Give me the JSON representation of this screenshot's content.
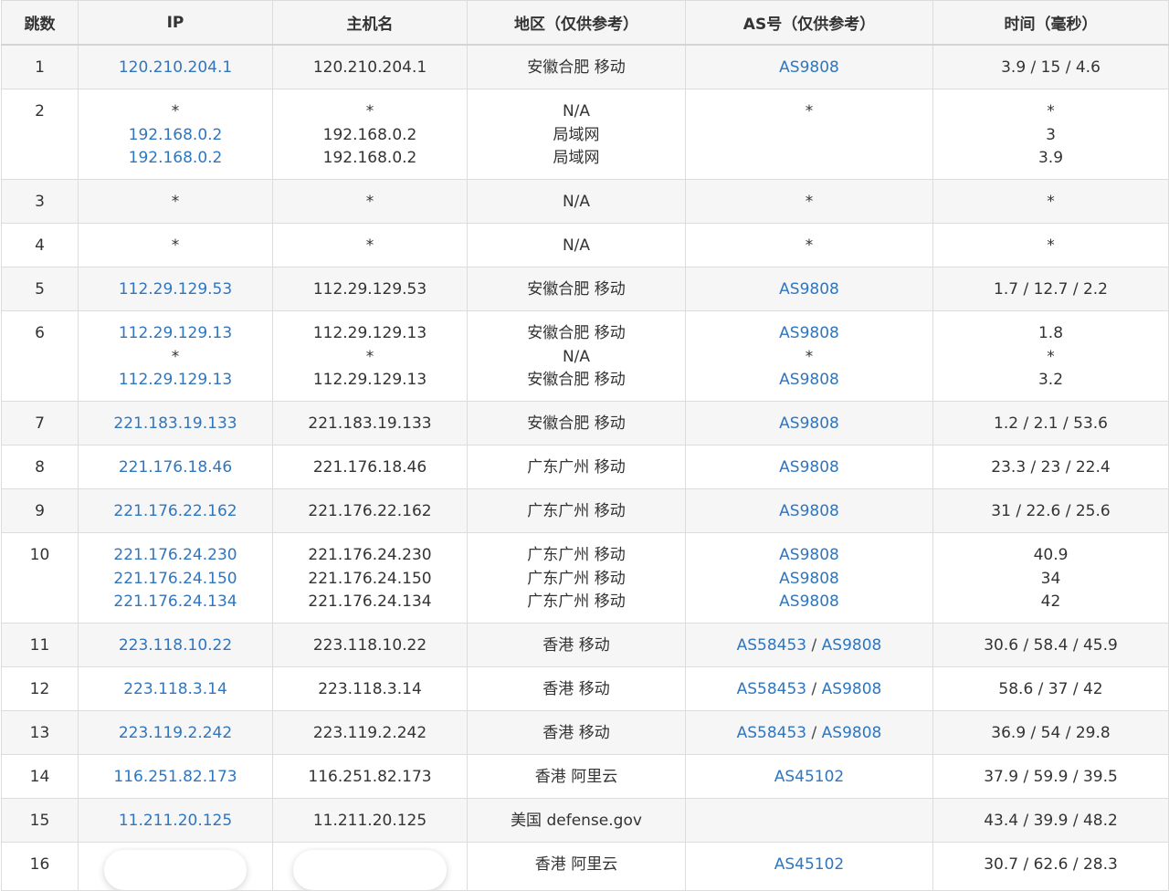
{
  "headers": [
    "跳数",
    "IP",
    "主机名",
    "地区（仅供参考）",
    "AS号（仅供参考）",
    "时间（毫秒）"
  ],
  "rows": [
    {
      "hop": "1",
      "ip": [
        "120.210.204.1"
      ],
      "host": [
        "120.210.204.1"
      ],
      "region": [
        "安徽合肥 移动"
      ],
      "as": [
        [
          "AS9808"
        ]
      ],
      "time": [
        "3.9 / 15 / 4.6"
      ]
    },
    {
      "hop": "2",
      "ip": [
        "*",
        "192.168.0.2",
        "192.168.0.2"
      ],
      "host": [
        "*",
        "192.168.0.2",
        "192.168.0.2"
      ],
      "region": [
        "N/A",
        "局域网",
        "局域网"
      ],
      "as": [
        [
          "*"
        ]
      ],
      "time": [
        "*",
        "3",
        "3.9"
      ]
    },
    {
      "hop": "3",
      "ip": [
        "*"
      ],
      "host": [
        "*"
      ],
      "region": [
        "N/A"
      ],
      "as": [
        [
          "*"
        ]
      ],
      "time": [
        "*"
      ]
    },
    {
      "hop": "4",
      "ip": [
        "*"
      ],
      "host": [
        "*"
      ],
      "region": [
        "N/A"
      ],
      "as": [
        [
          "*"
        ]
      ],
      "time": [
        "*"
      ]
    },
    {
      "hop": "5",
      "ip": [
        "112.29.129.53"
      ],
      "host": [
        "112.29.129.53"
      ],
      "region": [
        "安徽合肥 移动"
      ],
      "as": [
        [
          "AS9808"
        ]
      ],
      "time": [
        "1.7 / 12.7 / 2.2"
      ]
    },
    {
      "hop": "6",
      "ip": [
        "112.29.129.13",
        "*",
        "112.29.129.13"
      ],
      "host": [
        "112.29.129.13",
        "*",
        "112.29.129.13"
      ],
      "region": [
        "安徽合肥 移动",
        "N/A",
        "安徽合肥 移动"
      ],
      "as": [
        [
          "AS9808"
        ],
        [
          "*"
        ],
        [
          "AS9808"
        ]
      ],
      "time": [
        "1.8",
        "*",
        "3.2"
      ]
    },
    {
      "hop": "7",
      "ip": [
        "221.183.19.133"
      ],
      "host": [
        "221.183.19.133"
      ],
      "region": [
        "安徽合肥 移动"
      ],
      "as": [
        [
          "AS9808"
        ]
      ],
      "time": [
        "1.2 / 2.1 / 53.6"
      ]
    },
    {
      "hop": "8",
      "ip": [
        "221.176.18.46"
      ],
      "host": [
        "221.176.18.46"
      ],
      "region": [
        "广东广州 移动"
      ],
      "as": [
        [
          "AS9808"
        ]
      ],
      "time": [
        "23.3 / 23 / 22.4"
      ]
    },
    {
      "hop": "9",
      "ip": [
        "221.176.22.162"
      ],
      "host": [
        "221.176.22.162"
      ],
      "region": [
        "广东广州 移动"
      ],
      "as": [
        [
          "AS9808"
        ]
      ],
      "time": [
        "31 / 22.6 / 25.6"
      ]
    },
    {
      "hop": "10",
      "ip": [
        "221.176.24.230",
        "221.176.24.150",
        "221.176.24.134"
      ],
      "host": [
        "221.176.24.230",
        "221.176.24.150",
        "221.176.24.134"
      ],
      "region": [
        "广东广州 移动",
        "广东广州 移动",
        "广东广州 移动"
      ],
      "as": [
        [
          "AS9808"
        ],
        [
          "AS9808"
        ],
        [
          "AS9808"
        ]
      ],
      "time": [
        "40.9",
        "34",
        "42"
      ]
    },
    {
      "hop": "11",
      "ip": [
        "223.118.10.22"
      ],
      "host": [
        "223.118.10.22"
      ],
      "region": [
        "香港 移动"
      ],
      "as": [
        [
          "AS58453",
          "AS9808"
        ]
      ],
      "time": [
        "30.6 / 58.4 / 45.9"
      ]
    },
    {
      "hop": "12",
      "ip": [
        "223.118.3.14"
      ],
      "host": [
        "223.118.3.14"
      ],
      "region": [
        "香港 移动"
      ],
      "as": [
        [
          "AS58453",
          "AS9808"
        ]
      ],
      "time": [
        "58.6 / 37 / 42"
      ]
    },
    {
      "hop": "13",
      "ip": [
        "223.119.2.242"
      ],
      "host": [
        "223.119.2.242"
      ],
      "region": [
        "香港 移动"
      ],
      "as": [
        [
          "AS58453",
          "AS9808"
        ]
      ],
      "time": [
        "36.9 / 54 / 29.8"
      ]
    },
    {
      "hop": "14",
      "ip": [
        "116.251.82.173"
      ],
      "host": [
        "116.251.82.173"
      ],
      "region": [
        "香港 阿里云"
      ],
      "as": [
        [
          "AS45102"
        ]
      ],
      "time": [
        "37.9 / 59.9 / 39.5"
      ]
    },
    {
      "hop": "15",
      "ip": [
        "11.211.20.125"
      ],
      "host": [
        "11.211.20.125"
      ],
      "region": [
        "美国 defense.gov"
      ],
      "as": [],
      "time": [
        "43.4 / 39.9 / 48.2"
      ]
    },
    {
      "hop": "16",
      "ip": [],
      "host": [],
      "redacted": true,
      "region": [
        "香港 阿里云"
      ],
      "as": [
        [
          "AS45102"
        ]
      ],
      "time": [
        "30.7 / 62.6 / 28.3"
      ]
    }
  ]
}
